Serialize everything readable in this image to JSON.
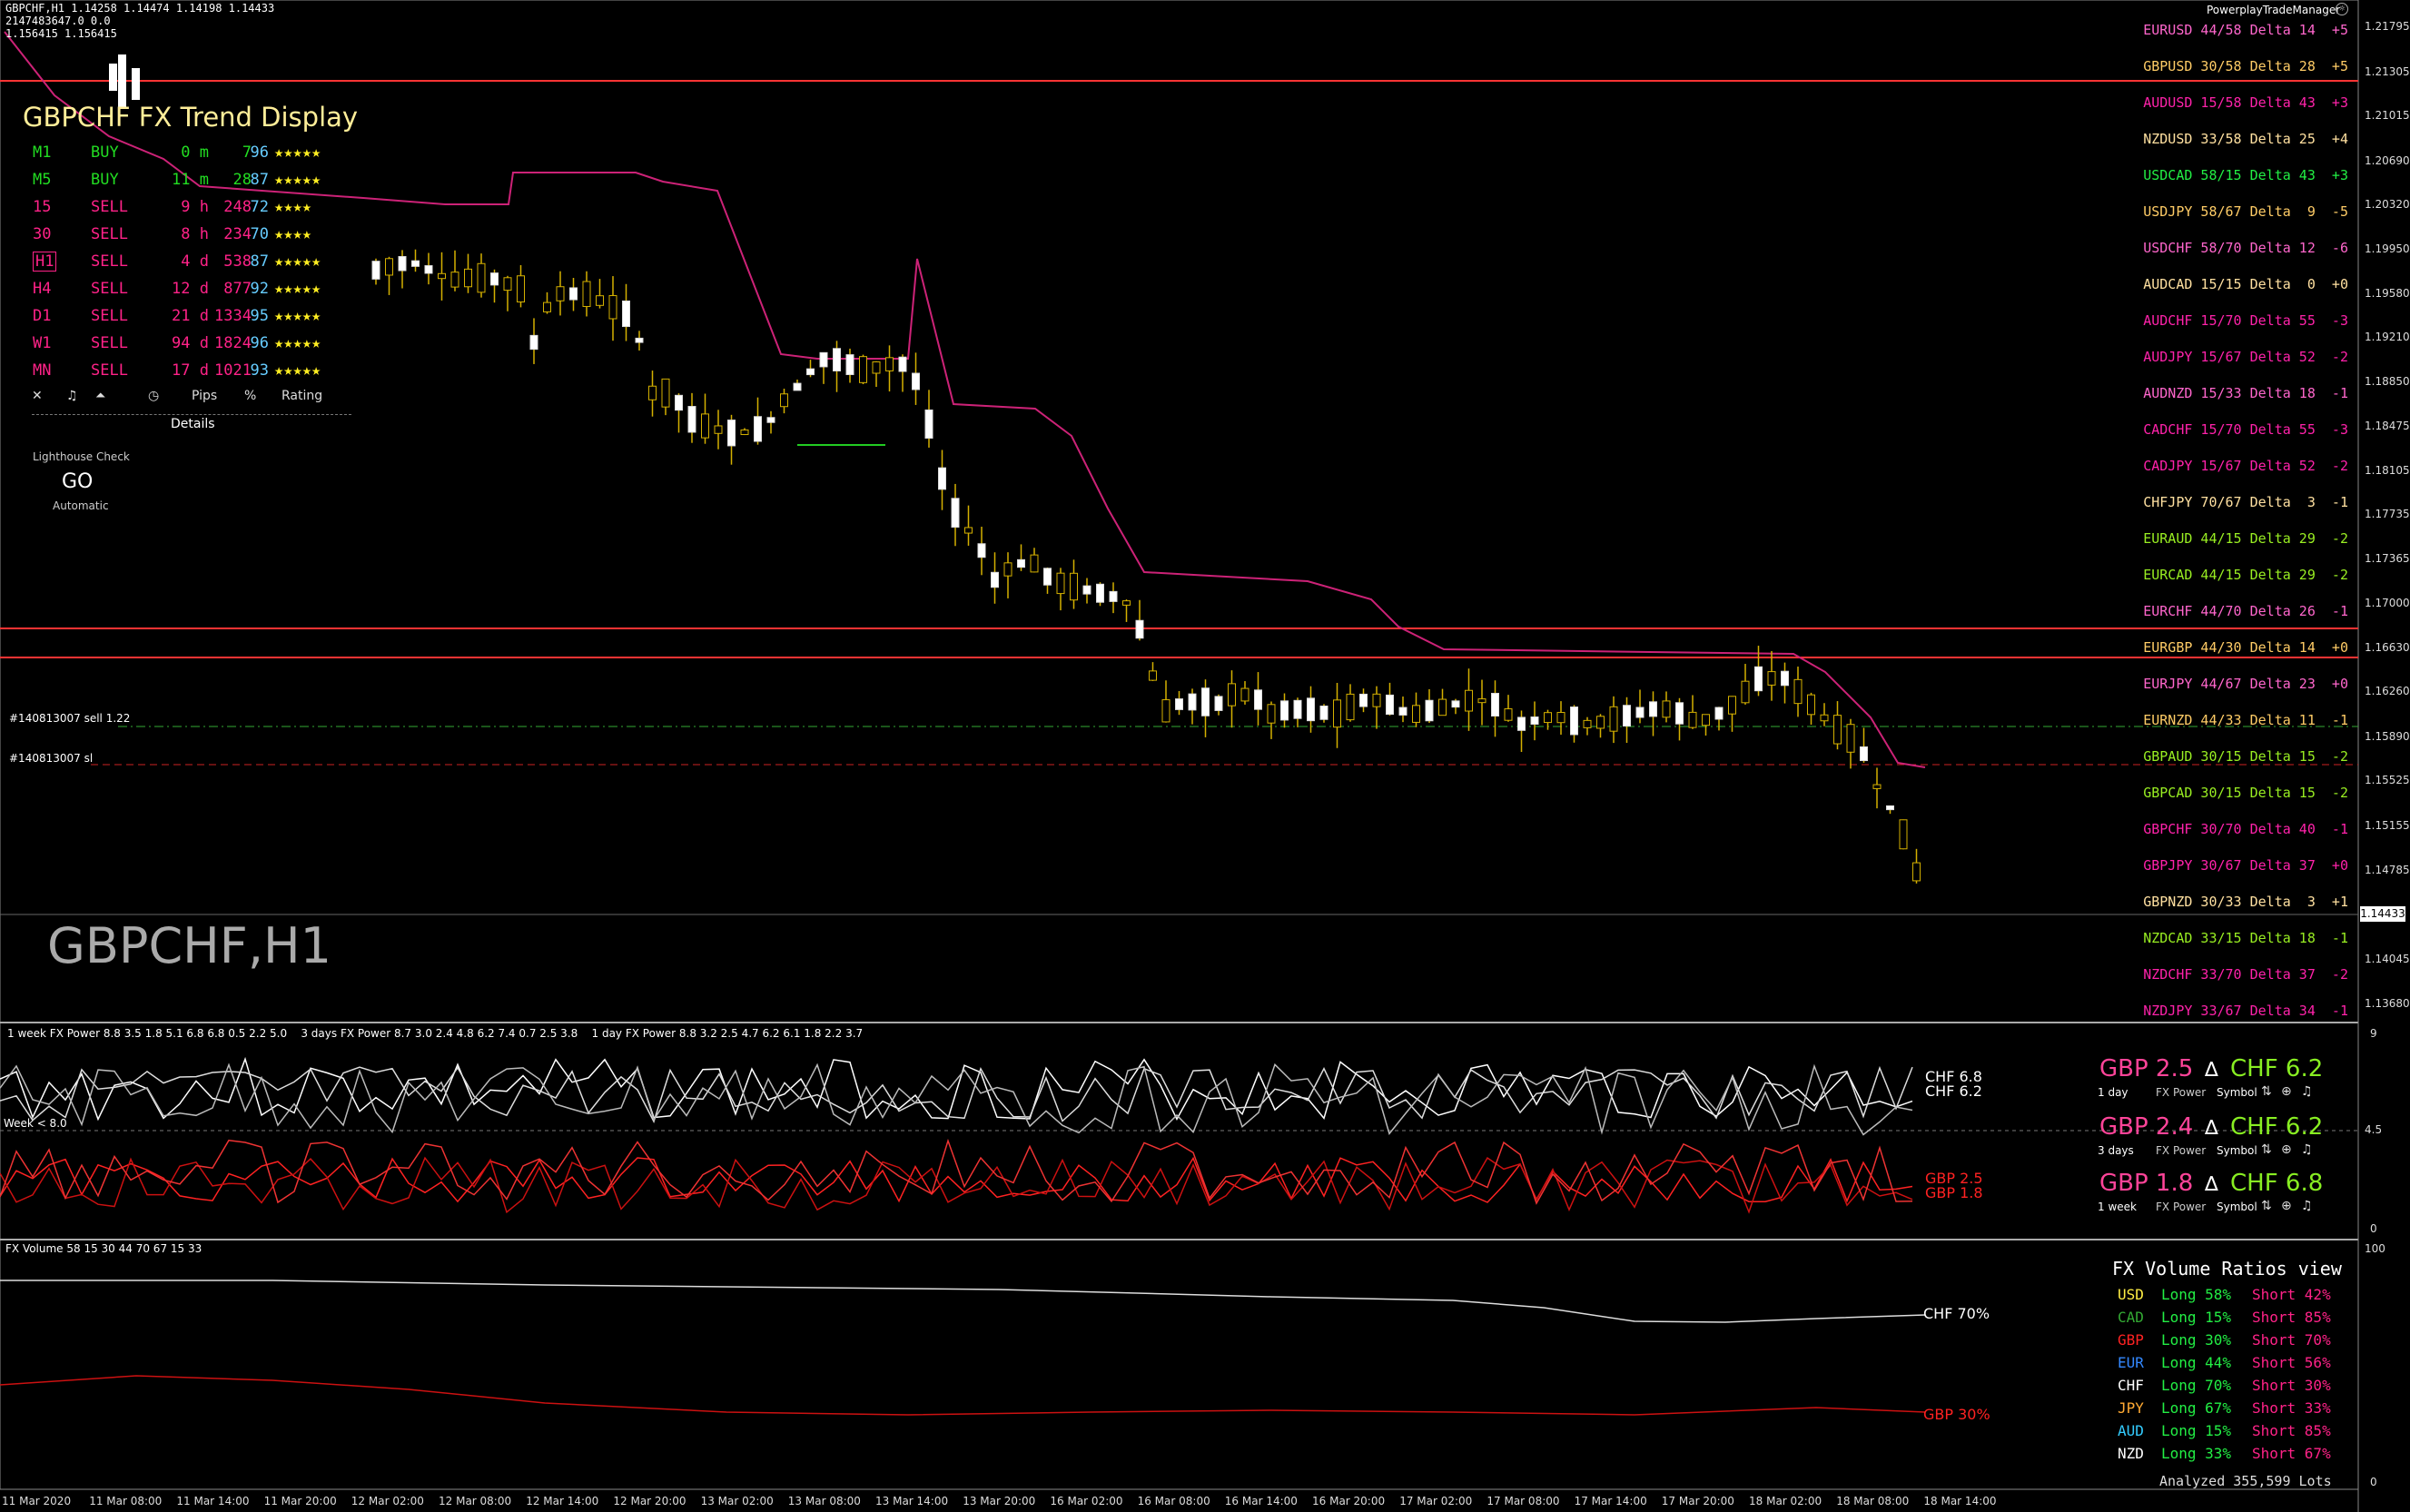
{
  "header": {
    "line1": "GBPCHF,H1  1.14258 1.14474 1.14198 1.14433",
    "line2": "2147483647.0  0.0",
    "line3": "1.156415  1.156415",
    "brand": "PowerplayTradeManager"
  },
  "watermark": "GBPCHF,H1",
  "trend_display": {
    "title": "GBPCHF FX Trend Display",
    "rows": [
      {
        "tf": "M1",
        "signal": "BUY",
        "age": "0 m",
        "pips": "7",
        "pct": "96",
        "stars": "★★★★★",
        "color": "#22dd22"
      },
      {
        "tf": "M5",
        "signal": "BUY",
        "age": "11 m",
        "pips": "28",
        "pct": "87",
        "stars": "★★★★★",
        "color": "#22dd22"
      },
      {
        "tf": "15",
        "signal": "SELL",
        "age": "9 h",
        "pips": "248",
        "pct": "72",
        "stars": "★★★★",
        "color": "#ff2288"
      },
      {
        "tf": "30",
        "signal": "SELL",
        "age": "8 h",
        "pips": "234",
        "pct": "70",
        "stars": "★★★★",
        "color": "#ff2288"
      },
      {
        "tf": "H1",
        "signal": "SELL",
        "age": "4 d",
        "pips": "538",
        "pct": "87",
        "stars": "★★★★★",
        "color": "#ff2288"
      },
      {
        "tf": "H4",
        "signal": "SELL",
        "age": "12 d",
        "pips": "877",
        "pct": "92",
        "stars": "★★★★★",
        "color": "#ff2288"
      },
      {
        "tf": "D1",
        "signal": "SELL",
        "age": "21 d",
        "pips": "1334",
        "pct": "95",
        "stars": "★★★★★",
        "color": "#ff2288"
      },
      {
        "tf": "W1",
        "signal": "SELL",
        "age": "94 d",
        "pips": "1824",
        "pct": "96",
        "stars": "★★★★★",
        "color": "#ff2288"
      },
      {
        "tf": "MN",
        "signal": "SELL",
        "age": "17 d",
        "pips": "1021",
        "pct": "93",
        "stars": "★★★★★",
        "color": "#ff2288"
      }
    ],
    "footer": {
      "close": "✕",
      "sound": "♫",
      "arrow": "⏶",
      "clock": "◷",
      "pips": "Pips",
      "pct": "%",
      "rating": "Rating"
    },
    "details": "Details"
  },
  "lighthouse": {
    "label": "Lighthouse Check",
    "value": "GO",
    "mode": "Automatic"
  },
  "order_labels": {
    "sell": "#140813007 sell 1.22",
    "sl": "#140813007 sl"
  },
  "pairs": [
    {
      "text": "EURUSD 44/58 Delta 14  +5",
      "color": "#ff66cc"
    },
    {
      "text": "GBPUSD 30/58 Delta 28  +5",
      "color": "#ffcc66"
    },
    {
      "text": "AUDUSD 15/58 Delta 43  +3",
      "color": "#ff22aa"
    },
    {
      "text": "NZDUSD 33/58 Delta 25  +4",
      "color": "#ffe0a0"
    },
    {
      "text": "USDCAD 58/15 Delta 43  +3",
      "color": "#22ee44"
    },
    {
      "text": "USDJPY 58/67 Delta  9  -5",
      "color": "#ffcc66"
    },
    {
      "text": "USDCHF 58/70 Delta 12  -6",
      "color": "#ff66cc"
    },
    {
      "text": "AUDCAD 15/15 Delta  0  +0",
      "color": "#ffe0a0"
    },
    {
      "text": "AUDCHF 15/70 Delta 55  -3",
      "color": "#ff22aa"
    },
    {
      "text": "AUDJPY 15/67 Delta 52  -2",
      "color": "#ff22aa"
    },
    {
      "text": "AUDNZD 15/33 Delta 18  -1",
      "color": "#ff66cc"
    },
    {
      "text": "CADCHF 15/70 Delta 55  -3",
      "color": "#ff22aa"
    },
    {
      "text": "CADJPY 15/67 Delta 52  -2",
      "color": "#ff22aa"
    },
    {
      "text": "CHFJPY 70/67 Delta  3  -1",
      "color": "#ffe0a0"
    },
    {
      "text": "EURAUD 44/15 Delta 29  -2",
      "color": "#99ee22"
    },
    {
      "text": "EURCAD 44/15 Delta 29  -2",
      "color": "#99ee22"
    },
    {
      "text": "EURCHF 44/70 Delta 26  -1",
      "color": "#ff66cc"
    },
    {
      "text": "EURGBP 44/30 Delta 14  +0",
      "color": "#ffcc66"
    },
    {
      "text": "EURJPY 44/67 Delta 23  +0",
      "color": "#ff66cc"
    },
    {
      "text": "EURNZD 44/33 Delta 11  -1",
      "color": "#ffcc66"
    },
    {
      "text": "GBPAUD 30/15 Delta 15  -2",
      "color": "#99ee22"
    },
    {
      "text": "GBPCAD 30/15 Delta 15  -2",
      "color": "#99ee22"
    },
    {
      "text": "GBPCHF 30/70 Delta 40  -1",
      "color": "#ff22aa"
    },
    {
      "text": "GBPJPY 30/67 Delta 37  +0",
      "color": "#ff22aa"
    },
    {
      "text": "GBPNZD 30/33 Delta  3  +1",
      "color": "#ffe0a0"
    },
    {
      "text": "NZDCAD 33/15 Delta 18  -1",
      "color": "#99ee22"
    },
    {
      "text": "NZDCHF 33/70 Delta 37  -2",
      "color": "#ff22aa"
    },
    {
      "text": "NZDJPY 33/67 Delta 34  -1",
      "color": "#ff22aa"
    }
  ],
  "price_axis": [
    "1.21795",
    "1.21305",
    "1.21015",
    "1.20690",
    "1.20320",
    "1.19950",
    "1.19580",
    "1.19210",
    "1.18850",
    "1.18475",
    "1.18105",
    "1.17735",
    "1.17365",
    "1.17000",
    "1.16630",
    "1.16260",
    "1.15890",
    "1.15525",
    "1.15155",
    "1.14785",
    "1.14433",
    "1.14045",
    "1.13680"
  ],
  "current_price": "1.14433",
  "time_axis": [
    "11 Mar 2020",
    "11 Mar 08:00",
    "11 Mar 14:00",
    "11 Mar 20:00",
    "12 Mar 02:00",
    "12 Mar 08:00",
    "12 Mar 14:00",
    "12 Mar 20:00",
    "13 Mar 02:00",
    "13 Mar 08:00",
    "13 Mar 14:00",
    "13 Mar 20:00",
    "16 Mar 02:00",
    "16 Mar 08:00",
    "16 Mar 14:00",
    "16 Mar 20:00",
    "17 Mar 02:00",
    "17 Mar 08:00",
    "17 Mar 14:00",
    "17 Mar 20:00",
    "18 Mar 02:00",
    "18 Mar 08:00",
    "18 Mar 14:00"
  ],
  "fx_power": {
    "header": "1 week FX Power 8.8 3.5 1.8 5.1 6.8 6.8 0.5 2.2 5.0    3 days FX Power 8.7 3.0 2.4 4.8 6.2 7.4 0.7 2.5 3.8    1 day FX Power 8.8 3.2 2.5 4.7 6.2 6.1 1.8 2.2 3.7",
    "week_label": "Week < 8.0",
    "line_labels": {
      "chf1": "CHF 6.8",
      "chf2": "CHF 6.2",
      "gbp1": "GBP 2.5",
      "gbp2": "GBP 1.8"
    },
    "axis": {
      "top": "9",
      "mid": "4.5",
      "bottom": "0"
    },
    "blocks": [
      {
        "base": "GBP 2.5",
        "delta": "∆",
        "quote": "CHF 6.2",
        "period": "1 day",
        "fx": "FX Power",
        "sym": "Symbol"
      },
      {
        "base": "GBP 2.4",
        "delta": "∆",
        "quote": "CHF 6.2",
        "period": "3 days",
        "fx": "FX Power",
        "sym": "Symbol"
      },
      {
        "base": "GBP 1.8",
        "delta": "∆",
        "quote": "CHF 6.8",
        "period": "1 week",
        "fx": "FX Power",
        "sym": "Symbol"
      }
    ],
    "colors": {
      "base": "#ff4499",
      "quote": "#88ee22"
    }
  },
  "fx_volume": {
    "header": "FX Volume 58 15 30 44 70 67 15 33",
    "title": "FX Volume Ratios view",
    "chf_label": "CHF 70%",
    "gbp_label": "GBP 30%",
    "axis": {
      "top": "100",
      "bottom": "0"
    },
    "rows": [
      {
        "cur": "USD",
        "long": "Long 58%",
        "short": "Short 42%",
        "color": "#ffee44"
      },
      {
        "cur": "CAD",
        "long": "Long 15%",
        "short": "Short 85%",
        "color": "#33aa33"
      },
      {
        "cur": "GBP",
        "long": "Long 30%",
        "short": "Short 70%",
        "color": "#ff2222"
      },
      {
        "cur": "EUR",
        "long": "Long 44%",
        "short": "Short 56%",
        "color": "#3388ff"
      },
      {
        "cur": "CHF",
        "long": "Long 70%",
        "short": "Short 30%",
        "color": "#ffffff"
      },
      {
        "cur": "JPY",
        "long": "Long 67%",
        "short": "Short 33%",
        "color": "#ffaa33"
      },
      {
        "cur": "AUD",
        "long": "Long 15%",
        "short": "Short 85%",
        "color": "#33ccff"
      },
      {
        "cur": "NZD",
        "long": "Long 33%",
        "short": "Short 67%",
        "color": "#ffffff"
      }
    ],
    "analyzed": "Analyzed 355,599 Lots"
  }
}
